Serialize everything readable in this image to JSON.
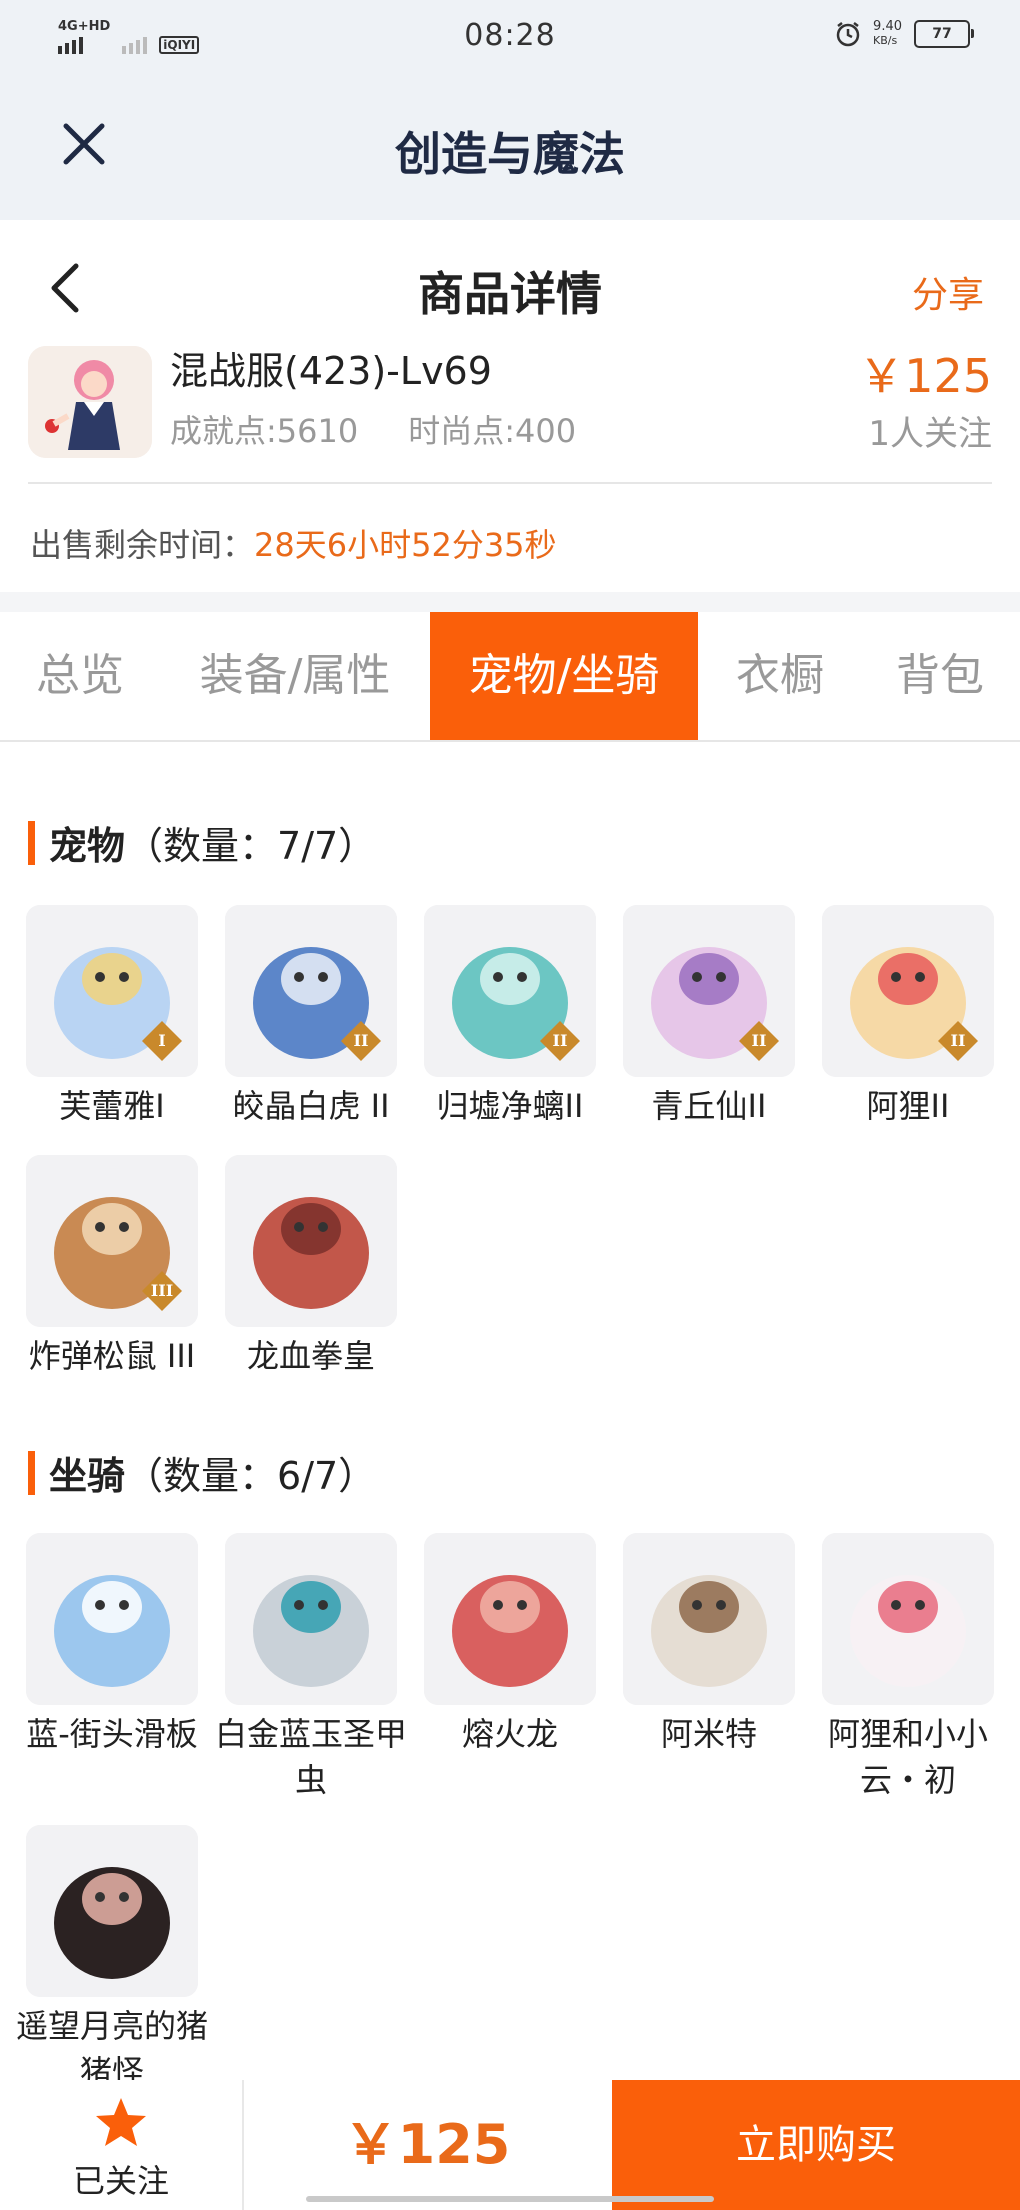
{
  "status_bar": {
    "network": "4G+HD",
    "carrier_icon": "iQIYI",
    "time": "08:28",
    "speed": "9.40",
    "speed_unit": "KB/s",
    "battery": "77"
  },
  "app_header": {
    "title": "创造与魔法"
  },
  "page_header": {
    "title": "商品详情",
    "share_label": "分享"
  },
  "product": {
    "name": "混战服(423)-Lv69",
    "achievement": "成就点:5610",
    "fashion": "时尚点:400",
    "price": "￥125",
    "followers": "1人关注",
    "remaining_label": "出售剩余时间：",
    "remaining_value": "28天6小时52分35秒"
  },
  "tabs": [
    {
      "label": "总览"
    },
    {
      "label": "装备/属性"
    },
    {
      "label": "宠物/坐骑"
    },
    {
      "label": "衣橱"
    },
    {
      "label": "背包"
    }
  ],
  "pets": {
    "title": "宠物",
    "count": "（数量：7/7）",
    "items": [
      {
        "label": "芙蕾雅I",
        "color": "#b9d4f3",
        "accent": "#f1d27a",
        "badge": "I"
      },
      {
        "label": "皎晶白虎 II",
        "color": "#5c86c9",
        "accent": "#e9eef8",
        "badge": "II"
      },
      {
        "label": "归墟净螭II",
        "color": "#6cc6c3",
        "accent": "#d6f2ef",
        "badge": "II"
      },
      {
        "label": "青丘仙II",
        "color": "#e6c6e8",
        "accent": "#9a6fc0",
        "badge": "II"
      },
      {
        "label": "阿狸II",
        "color": "#f6d9a6",
        "accent": "#e85c5c",
        "badge": "II"
      },
      {
        "label": "炸弹松鼠 III",
        "color": "#c98a53",
        "accent": "#f2d8b6",
        "badge": "III"
      },
      {
        "label": "龙血拳皇",
        "color": "#c2574a",
        "accent": "#7a2f2a",
        "badge": ""
      }
    ]
  },
  "mounts": {
    "title": "坐骑",
    "count": "（数量：6/7）",
    "items": [
      {
        "label": "蓝-街头滑板",
        "color": "#9cc7ee",
        "accent": "#ffffff"
      },
      {
        "label": "白金蓝玉圣甲虫",
        "color": "#c9d1d8",
        "accent": "#2f9fb0"
      },
      {
        "label": "熔火龙",
        "color": "#d9605f",
        "accent": "#f0b2a6"
      },
      {
        "label": "阿米特",
        "color": "#e5ddd3",
        "accent": "#8f6a4b"
      },
      {
        "label": "阿狸和小小云・初",
        "color": "#f7f1f4",
        "accent": "#e86a7c"
      },
      {
        "label": "遥望月亮的猪猪怪",
        "color": "#2b2222",
        "accent": "#e9b3a8"
      }
    ]
  },
  "bottom_bar": {
    "follow_label": "已关注",
    "price": "￥125",
    "buy_label": "立即购买"
  }
}
